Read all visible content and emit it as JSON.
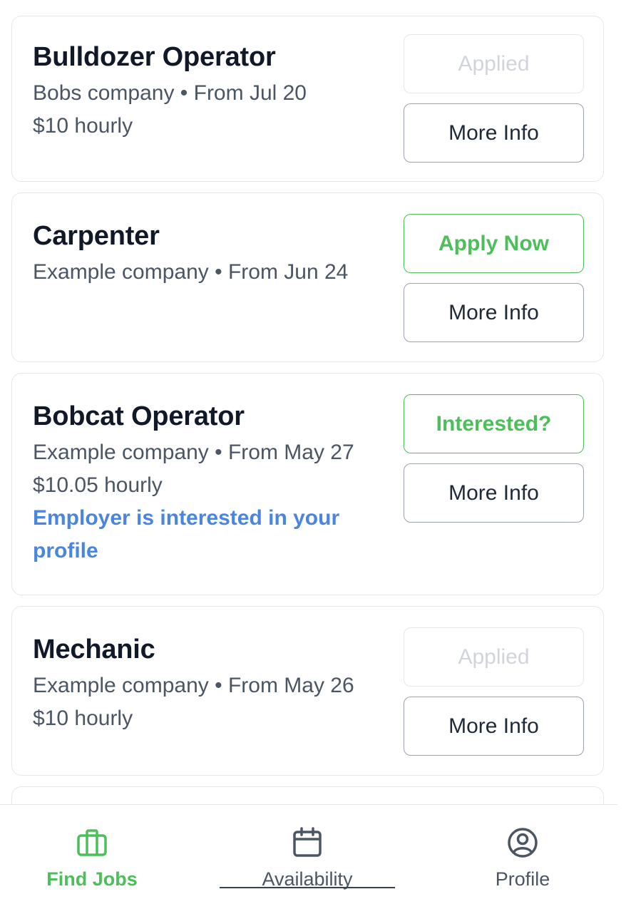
{
  "jobs": [
    {
      "title": "Bulldozer Operator",
      "meta": "Bobs company • From Jul 20",
      "pay": "$10 hourly",
      "primary_label": "Applied",
      "more_label": "More Info"
    },
    {
      "title": "Carpenter",
      "meta": "Example company • From Jun 24",
      "primary_label": "Apply Now",
      "more_label": "More Info"
    },
    {
      "title": "Bobcat Operator",
      "meta": "Example company • From May 27",
      "pay": "$10.05 hourly",
      "note": "Employer is interested in your profile",
      "primary_label": "Interested?",
      "more_label": "More Info"
    },
    {
      "title": "Mechanic",
      "meta": "Example company • From May 26",
      "pay": "$10 hourly",
      "primary_label": "Applied",
      "more_label": "More Info"
    }
  ],
  "tabbar": {
    "find_jobs": {
      "label": "Find Jobs",
      "icon": "briefcase-icon"
    },
    "availability": {
      "label": "Availability",
      "icon": "calendar-icon"
    },
    "profile": {
      "label": "Profile",
      "icon": "user-circle-icon"
    }
  },
  "colors": {
    "accent_green": "#4cbf5a",
    "link_blue": "#4a86e0",
    "title": "#111827",
    "muted": "#4b5563",
    "border": "#e5e7eb"
  }
}
